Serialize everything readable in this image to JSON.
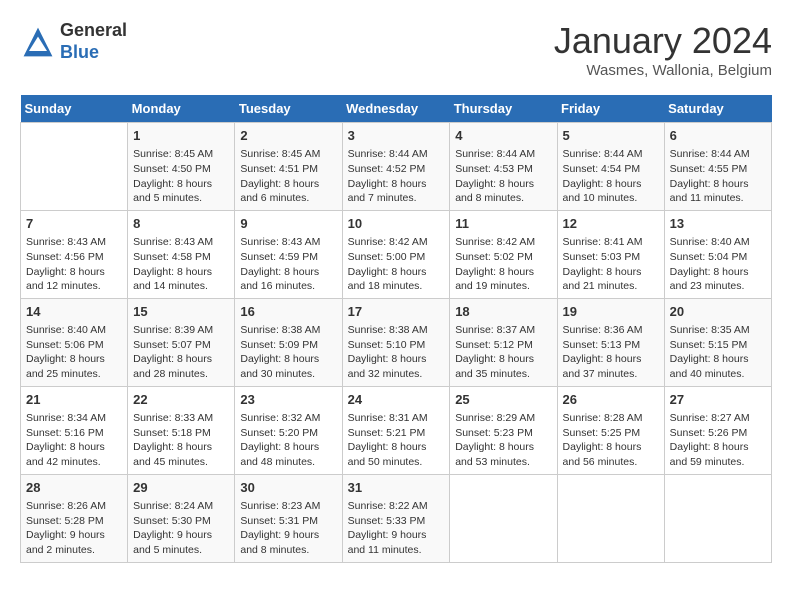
{
  "header": {
    "logo_general": "General",
    "logo_blue": "Blue",
    "title": "January 2024",
    "subtitle": "Wasmes, Wallonia, Belgium"
  },
  "days_of_week": [
    "Sunday",
    "Monday",
    "Tuesday",
    "Wednesday",
    "Thursday",
    "Friday",
    "Saturday"
  ],
  "weeks": [
    [
      {
        "day": "",
        "sunrise": "",
        "sunset": "",
        "daylight": ""
      },
      {
        "day": "1",
        "sunrise": "Sunrise: 8:45 AM",
        "sunset": "Sunset: 4:50 PM",
        "daylight": "Daylight: 8 hours and 5 minutes."
      },
      {
        "day": "2",
        "sunrise": "Sunrise: 8:45 AM",
        "sunset": "Sunset: 4:51 PM",
        "daylight": "Daylight: 8 hours and 6 minutes."
      },
      {
        "day": "3",
        "sunrise": "Sunrise: 8:44 AM",
        "sunset": "Sunset: 4:52 PM",
        "daylight": "Daylight: 8 hours and 7 minutes."
      },
      {
        "day": "4",
        "sunrise": "Sunrise: 8:44 AM",
        "sunset": "Sunset: 4:53 PM",
        "daylight": "Daylight: 8 hours and 8 minutes."
      },
      {
        "day": "5",
        "sunrise": "Sunrise: 8:44 AM",
        "sunset": "Sunset: 4:54 PM",
        "daylight": "Daylight: 8 hours and 10 minutes."
      },
      {
        "day": "6",
        "sunrise": "Sunrise: 8:44 AM",
        "sunset": "Sunset: 4:55 PM",
        "daylight": "Daylight: 8 hours and 11 minutes."
      }
    ],
    [
      {
        "day": "7",
        "sunrise": "Sunrise: 8:43 AM",
        "sunset": "Sunset: 4:56 PM",
        "daylight": "Daylight: 8 hours and 12 minutes."
      },
      {
        "day": "8",
        "sunrise": "Sunrise: 8:43 AM",
        "sunset": "Sunset: 4:58 PM",
        "daylight": "Daylight: 8 hours and 14 minutes."
      },
      {
        "day": "9",
        "sunrise": "Sunrise: 8:43 AM",
        "sunset": "Sunset: 4:59 PM",
        "daylight": "Daylight: 8 hours and 16 minutes."
      },
      {
        "day": "10",
        "sunrise": "Sunrise: 8:42 AM",
        "sunset": "Sunset: 5:00 PM",
        "daylight": "Daylight: 8 hours and 18 minutes."
      },
      {
        "day": "11",
        "sunrise": "Sunrise: 8:42 AM",
        "sunset": "Sunset: 5:02 PM",
        "daylight": "Daylight: 8 hours and 19 minutes."
      },
      {
        "day": "12",
        "sunrise": "Sunrise: 8:41 AM",
        "sunset": "Sunset: 5:03 PM",
        "daylight": "Daylight: 8 hours and 21 minutes."
      },
      {
        "day": "13",
        "sunrise": "Sunrise: 8:40 AM",
        "sunset": "Sunset: 5:04 PM",
        "daylight": "Daylight: 8 hours and 23 minutes."
      }
    ],
    [
      {
        "day": "14",
        "sunrise": "Sunrise: 8:40 AM",
        "sunset": "Sunset: 5:06 PM",
        "daylight": "Daylight: 8 hours and 25 minutes."
      },
      {
        "day": "15",
        "sunrise": "Sunrise: 8:39 AM",
        "sunset": "Sunset: 5:07 PM",
        "daylight": "Daylight: 8 hours and 28 minutes."
      },
      {
        "day": "16",
        "sunrise": "Sunrise: 8:38 AM",
        "sunset": "Sunset: 5:09 PM",
        "daylight": "Daylight: 8 hours and 30 minutes."
      },
      {
        "day": "17",
        "sunrise": "Sunrise: 8:38 AM",
        "sunset": "Sunset: 5:10 PM",
        "daylight": "Daylight: 8 hours and 32 minutes."
      },
      {
        "day": "18",
        "sunrise": "Sunrise: 8:37 AM",
        "sunset": "Sunset: 5:12 PM",
        "daylight": "Daylight: 8 hours and 35 minutes."
      },
      {
        "day": "19",
        "sunrise": "Sunrise: 8:36 AM",
        "sunset": "Sunset: 5:13 PM",
        "daylight": "Daylight: 8 hours and 37 minutes."
      },
      {
        "day": "20",
        "sunrise": "Sunrise: 8:35 AM",
        "sunset": "Sunset: 5:15 PM",
        "daylight": "Daylight: 8 hours and 40 minutes."
      }
    ],
    [
      {
        "day": "21",
        "sunrise": "Sunrise: 8:34 AM",
        "sunset": "Sunset: 5:16 PM",
        "daylight": "Daylight: 8 hours and 42 minutes."
      },
      {
        "day": "22",
        "sunrise": "Sunrise: 8:33 AM",
        "sunset": "Sunset: 5:18 PM",
        "daylight": "Daylight: 8 hours and 45 minutes."
      },
      {
        "day": "23",
        "sunrise": "Sunrise: 8:32 AM",
        "sunset": "Sunset: 5:20 PM",
        "daylight": "Daylight: 8 hours and 48 minutes."
      },
      {
        "day": "24",
        "sunrise": "Sunrise: 8:31 AM",
        "sunset": "Sunset: 5:21 PM",
        "daylight": "Daylight: 8 hours and 50 minutes."
      },
      {
        "day": "25",
        "sunrise": "Sunrise: 8:29 AM",
        "sunset": "Sunset: 5:23 PM",
        "daylight": "Daylight: 8 hours and 53 minutes."
      },
      {
        "day": "26",
        "sunrise": "Sunrise: 8:28 AM",
        "sunset": "Sunset: 5:25 PM",
        "daylight": "Daylight: 8 hours and 56 minutes."
      },
      {
        "day": "27",
        "sunrise": "Sunrise: 8:27 AM",
        "sunset": "Sunset: 5:26 PM",
        "daylight": "Daylight: 8 hours and 59 minutes."
      }
    ],
    [
      {
        "day": "28",
        "sunrise": "Sunrise: 8:26 AM",
        "sunset": "Sunset: 5:28 PM",
        "daylight": "Daylight: 9 hours and 2 minutes."
      },
      {
        "day": "29",
        "sunrise": "Sunrise: 8:24 AM",
        "sunset": "Sunset: 5:30 PM",
        "daylight": "Daylight: 9 hours and 5 minutes."
      },
      {
        "day": "30",
        "sunrise": "Sunrise: 8:23 AM",
        "sunset": "Sunset: 5:31 PM",
        "daylight": "Daylight: 9 hours and 8 minutes."
      },
      {
        "day": "31",
        "sunrise": "Sunrise: 8:22 AM",
        "sunset": "Sunset: 5:33 PM",
        "daylight": "Daylight: 9 hours and 11 minutes."
      },
      {
        "day": "",
        "sunrise": "",
        "sunset": "",
        "daylight": ""
      },
      {
        "day": "",
        "sunrise": "",
        "sunset": "",
        "daylight": ""
      },
      {
        "day": "",
        "sunrise": "",
        "sunset": "",
        "daylight": ""
      }
    ]
  ]
}
